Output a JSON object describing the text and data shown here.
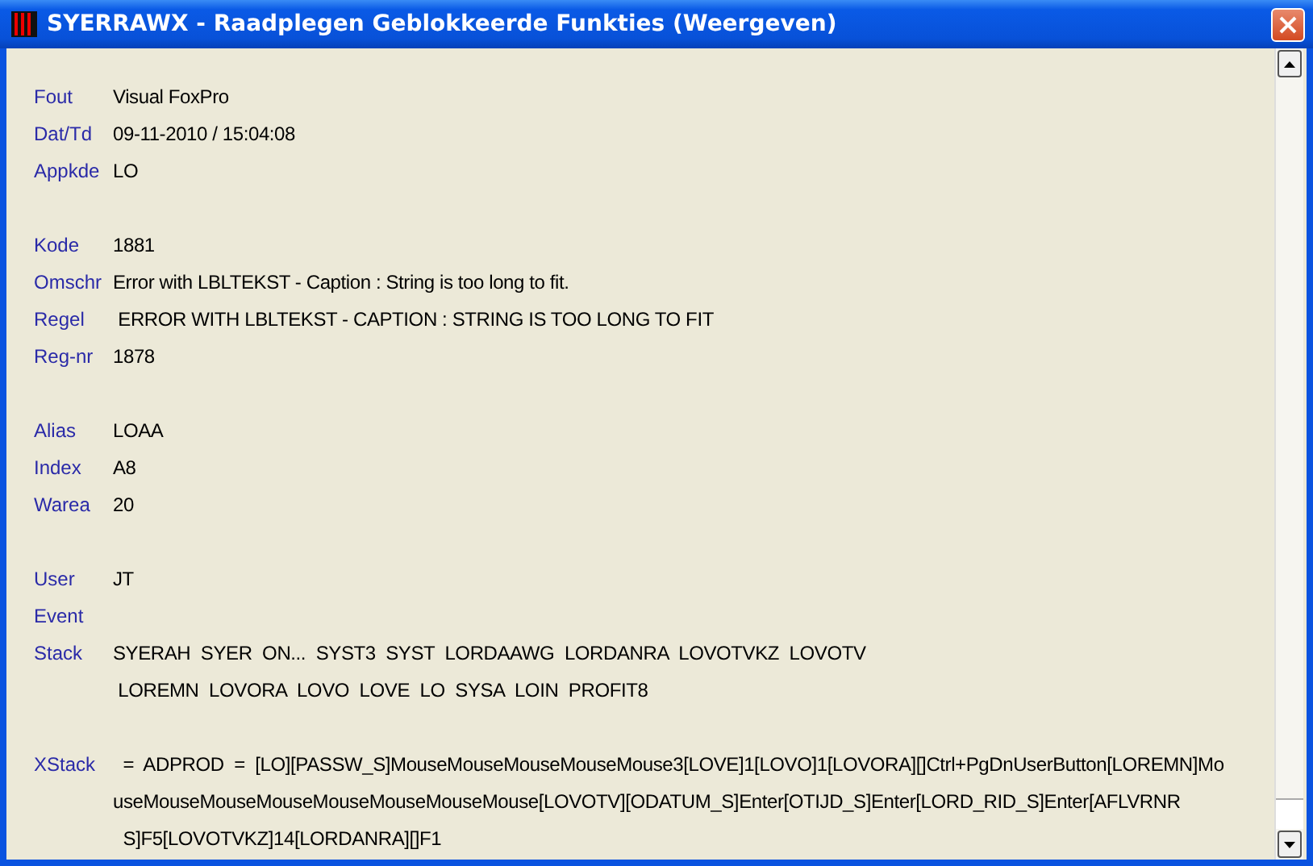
{
  "window": {
    "title": "SYERRAWX - Raadplegen Geblokkeerde Funkties (Weergeven)"
  },
  "groups": [
    {
      "fields": [
        {
          "label": "Fout",
          "lines": [
            "Visual FoxPro"
          ]
        },
        {
          "label": "Dat/Td",
          "lines": [
            "09-11-2010 / 15:04:08"
          ]
        },
        {
          "label": "Appkde",
          "lines": [
            "LO"
          ]
        }
      ]
    },
    {
      "fields": [
        {
          "label": "Kode",
          "lines": [
            "1881"
          ]
        },
        {
          "label": "Omschr",
          "lines": [
            "Error with LBLTEKST - Caption : String is too long to fit."
          ]
        },
        {
          "label": "Regel",
          "lines": [
            " ERROR WITH LBLTEKST - CAPTION : STRING IS TOO LONG TO FIT"
          ]
        },
        {
          "label": "Reg-nr",
          "lines": [
            "1878"
          ]
        }
      ]
    },
    {
      "fields": [
        {
          "label": "Alias",
          "lines": [
            "LOAA"
          ]
        },
        {
          "label": "Index",
          "lines": [
            "A8"
          ]
        },
        {
          "label": "Warea",
          "lines": [
            "20"
          ]
        }
      ]
    },
    {
      "fields": [
        {
          "label": "User",
          "lines": [
            "JT"
          ]
        },
        {
          "label": "Event"
        },
        {
          "label": "Stack",
          "lines": [
            "SYERAH  SYER  ON...  SYST3  SYST  LORDAAWG  LORDANRA  LOVOTVKZ  LOVOTV",
            " LOREMN  LOVORA  LOVO  LOVE  LO  SYSA  LOIN  PROFIT8"
          ]
        }
      ]
    },
    {
      "fields": [
        {
          "label": "XStack",
          "lines": [
            "  =  ADPROD  =  [LO][PASSW_S]MouseMouseMouseMouseMouse3[LOVE]1[LOVO]1[LOVORA][]Ctrl+PgDnUserButton[LOREMN]Mo",
            "useMouseMouseMouseMouseMouseMouseMouse[LOVOTV][ODATUM_S]Enter[OTIJD_S]Enter[LORD_RID_S]Enter[AFLVRNR",
            "  S]F5[LOVOTVKZ]14[LORDANRA][]F1"
          ]
        }
      ]
    }
  ]
}
